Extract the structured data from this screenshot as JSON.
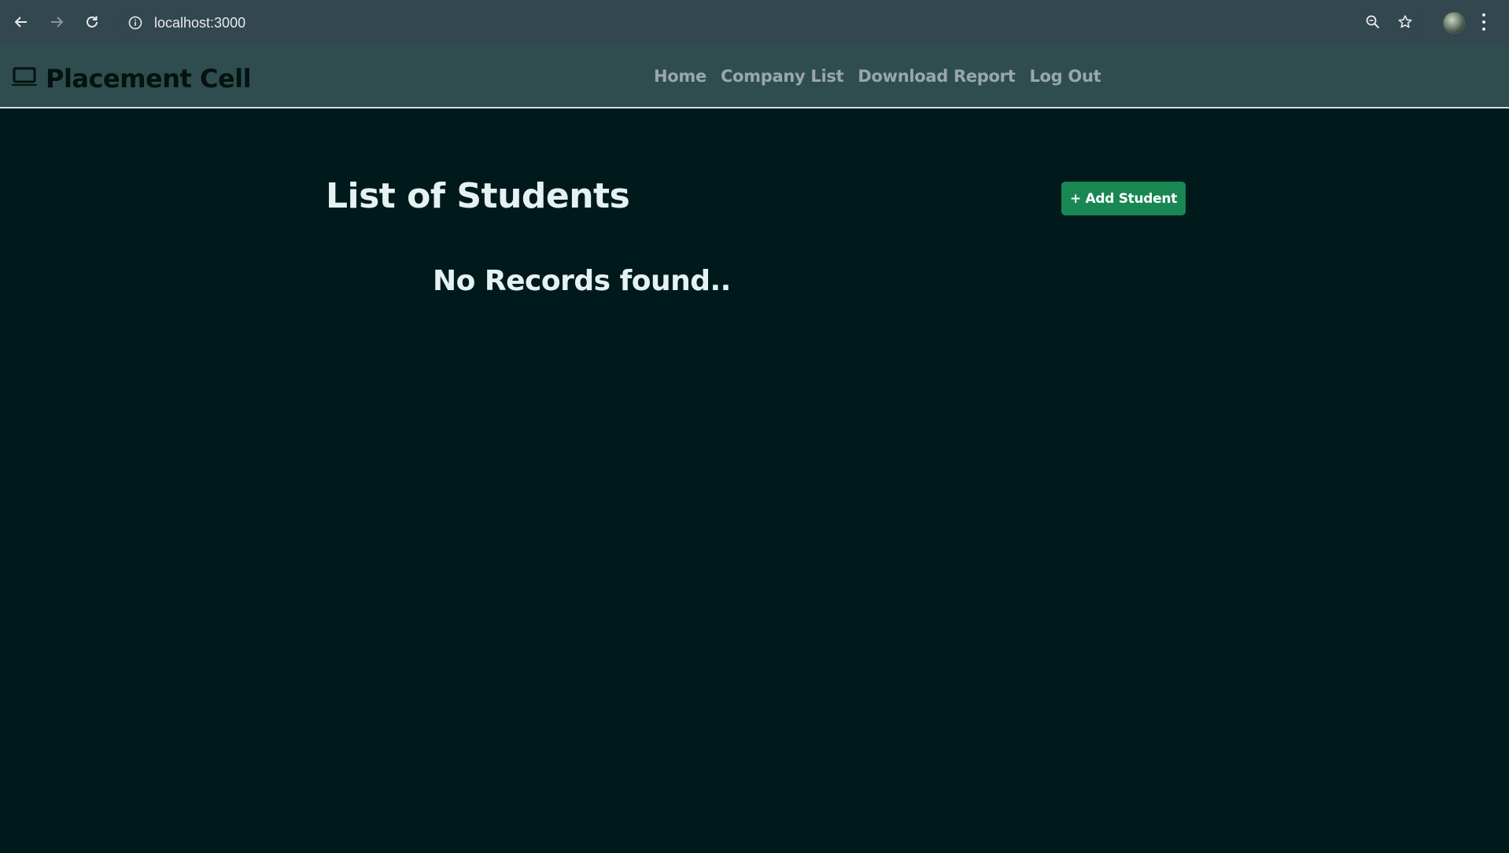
{
  "browser": {
    "url": "localhost:3000",
    "icons": [
      "back-arrow-icon",
      "forward-arrow-icon",
      "reload-icon",
      "site-info-icon",
      "zoom-icon",
      "bookmark-star-icon",
      "profile-avatar",
      "menu-kebab-icon"
    ]
  },
  "navbar": {
    "brand_icon": "laptop-icon",
    "brand": "Placement Cell",
    "links": [
      {
        "label": "Home"
      },
      {
        "label": "Company List"
      },
      {
        "label": "Download Report"
      },
      {
        "label": "Log Out"
      }
    ]
  },
  "main": {
    "title": "List of Students",
    "add_button": "+ Add Student",
    "empty_message": "No Records found.."
  },
  "colors": {
    "page_background": "#001a1c",
    "navbar_background": "#2f4d4f",
    "browser_chrome": "#33474f",
    "add_button": "#198754",
    "nav_link": "#9aa7a8",
    "heading_text": "#e6f2f2"
  }
}
